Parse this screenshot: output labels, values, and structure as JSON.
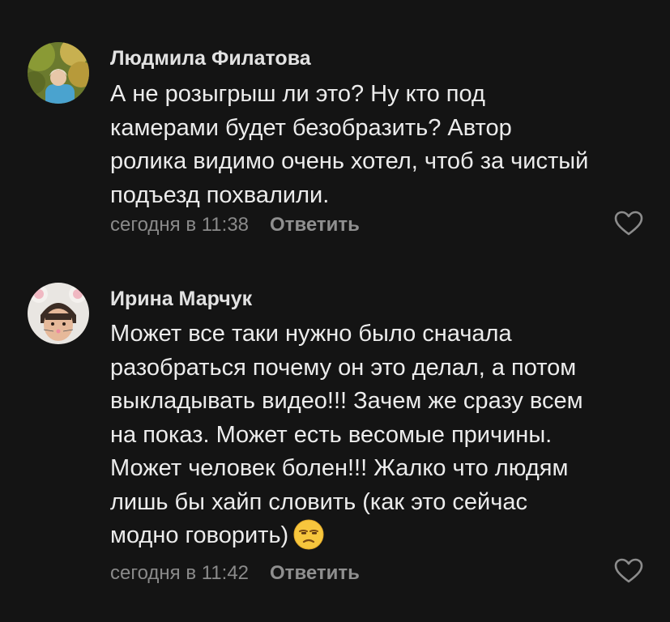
{
  "comments": [
    {
      "author": "Людмила Филатова",
      "avatar_icon": "user-photo-autumn",
      "text_lines": [
        "А не розыгрыш ли это? Ну кто под",
        "камерами будет безобразить? Автор",
        "ролика видимо очень хотел, чтоб за чистый",
        "подъезд похвалили."
      ],
      "time": "сегодня в 11:38",
      "reply_label": "Ответить",
      "like_icon": "heart-outline-icon"
    },
    {
      "author": "Ирина Марчук",
      "avatar_icon": "user-photo-mouse-filter",
      "text_lines": [
        "Может все таки нужно было сначала",
        "разобраться почему он это делал, а потом",
        "выкладывать видео!!! Зачем же сразу всем",
        "на показ. Может есть весомые причины.",
        "Может человек болен!!! Жалко что людям",
        "лишь бы хайп словить (как это сейчас",
        "модно говорить)"
      ],
      "emoji": "unamused-face",
      "time": "сегодня в 11:42",
      "reply_label": "Ответить",
      "like_icon": "heart-outline-icon"
    }
  ],
  "colors": {
    "background": "#141414",
    "text": "#ececec",
    "author": "#e2e2e2",
    "meta": "#8a8a8a"
  }
}
